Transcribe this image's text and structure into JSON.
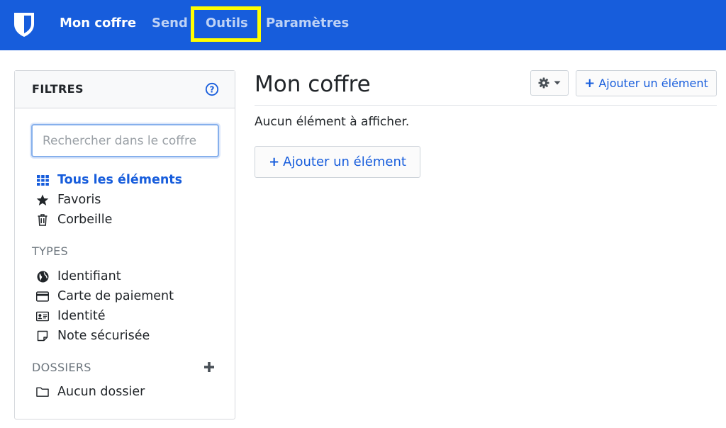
{
  "nav": {
    "items": [
      {
        "label": "Mon coffre",
        "active": true
      },
      {
        "label": "Send",
        "active": false
      },
      {
        "label": "Outils",
        "active": false,
        "highlighted": true
      },
      {
        "label": "Paramètres",
        "active": false
      }
    ]
  },
  "filters": {
    "title": "FILTRES",
    "search_placeholder": "Rechercher dans le coffre",
    "main": [
      {
        "label": "Tous les éléments",
        "icon": "grid-icon",
        "active": true
      },
      {
        "label": "Favoris",
        "icon": "star-icon",
        "active": false
      },
      {
        "label": "Corbeille",
        "icon": "trash-icon",
        "active": false
      }
    ],
    "types_label": "TYPES",
    "types": [
      {
        "label": "Identifiant",
        "icon": "globe-icon"
      },
      {
        "label": "Carte de paiement",
        "icon": "credit-card-icon"
      },
      {
        "label": "Identité",
        "icon": "id-card-icon"
      },
      {
        "label": "Note sécurisée",
        "icon": "note-icon"
      }
    ],
    "folders_label": "DOSSIERS",
    "folders": [
      {
        "label": "Aucun dossier",
        "icon": "folder-icon"
      }
    ]
  },
  "main": {
    "title": "Mon coffre",
    "add_button_label": "Ajouter un élément",
    "empty_text": "Aucun élément à afficher.",
    "empty_add_label": "Ajouter un élément"
  },
  "colors": {
    "brand": "#175ddc",
    "highlight": "#ffff00"
  }
}
